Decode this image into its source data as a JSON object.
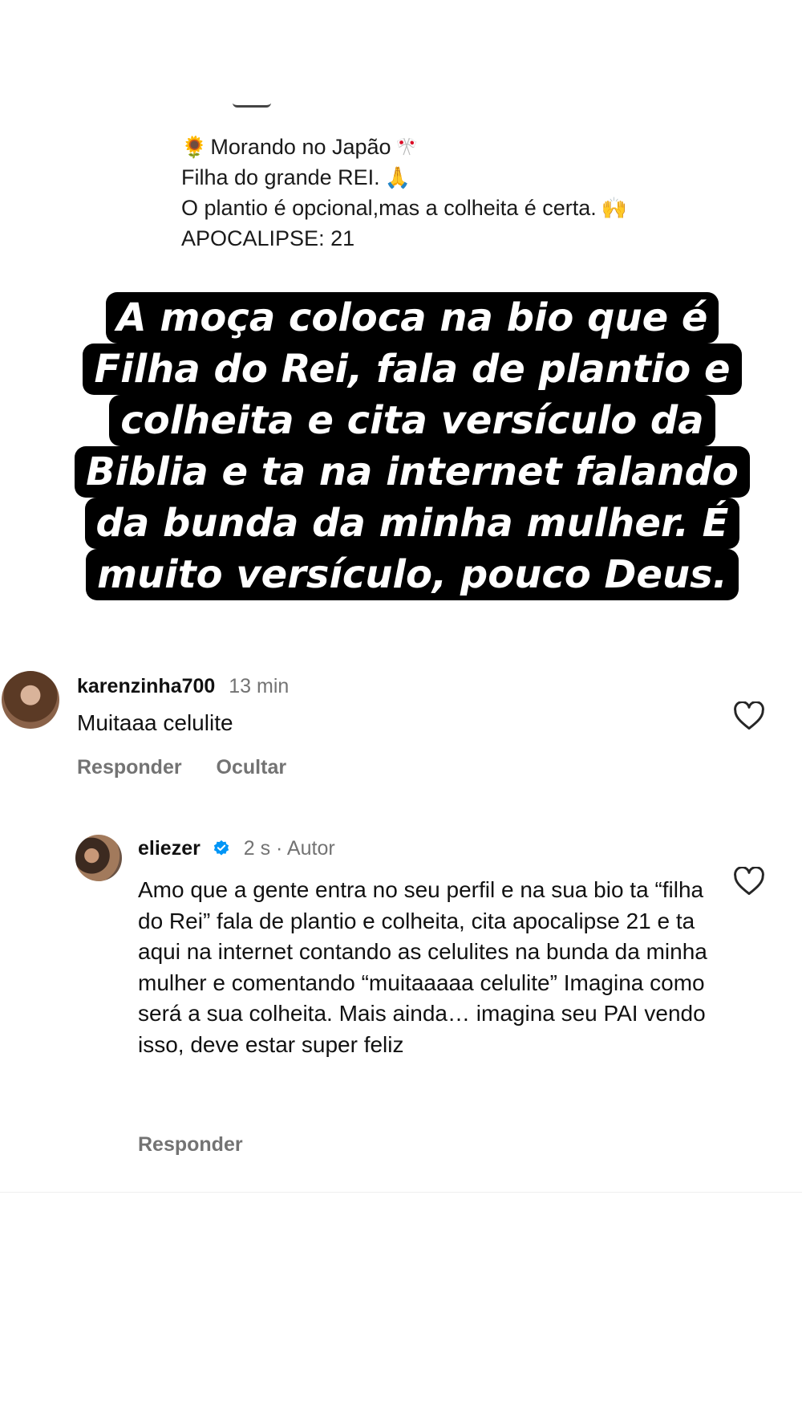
{
  "bio": {
    "lines": [
      "Morando no Japão",
      "Filha do grande REI.",
      "O plantio é opcional,mas a colheita é certa.",
      "APOCALIPSE: 21"
    ],
    "icons": [
      "sunflower-emoji",
      "japan-flags-emoji",
      "praying-hands-emoji",
      "raised-hands-emoji"
    ]
  },
  "caption": {
    "lines": [
      "A moça coloca na bio que é",
      "Filha do Rei, fala de plantio e",
      "colheita e cita versículo da",
      "Biblia e ta na internet falando",
      "da bunda da minha mulher. É",
      "muito versículo, pouco Deus."
    ]
  },
  "comments": [
    {
      "username": "karenzinha700",
      "time": "13 min",
      "text": "Muitaaa celulite",
      "reply_label": "Responder",
      "hide_label": "Ocultar"
    },
    {
      "username": "eliezer",
      "time": "2 s · Autor",
      "text": "Amo que a gente entra no seu perfil e na sua bio ta “filha do Rei” fala de plantio e colheita, cita apocalipse 21 e ta aqui na internet contando as celulites na bunda da minha mulher e comentando “muitaaaaa celulite” Imagina como será a sua colheita. Mais ainda… imagina seu PAI vendo isso, deve estar super feliz",
      "reply_label": "Responder"
    }
  ],
  "colors": {
    "caption_background": "#000000",
    "caption_text": "#ffffff",
    "secondary_text": "#737373",
    "verified_badge": "#0095f6"
  }
}
